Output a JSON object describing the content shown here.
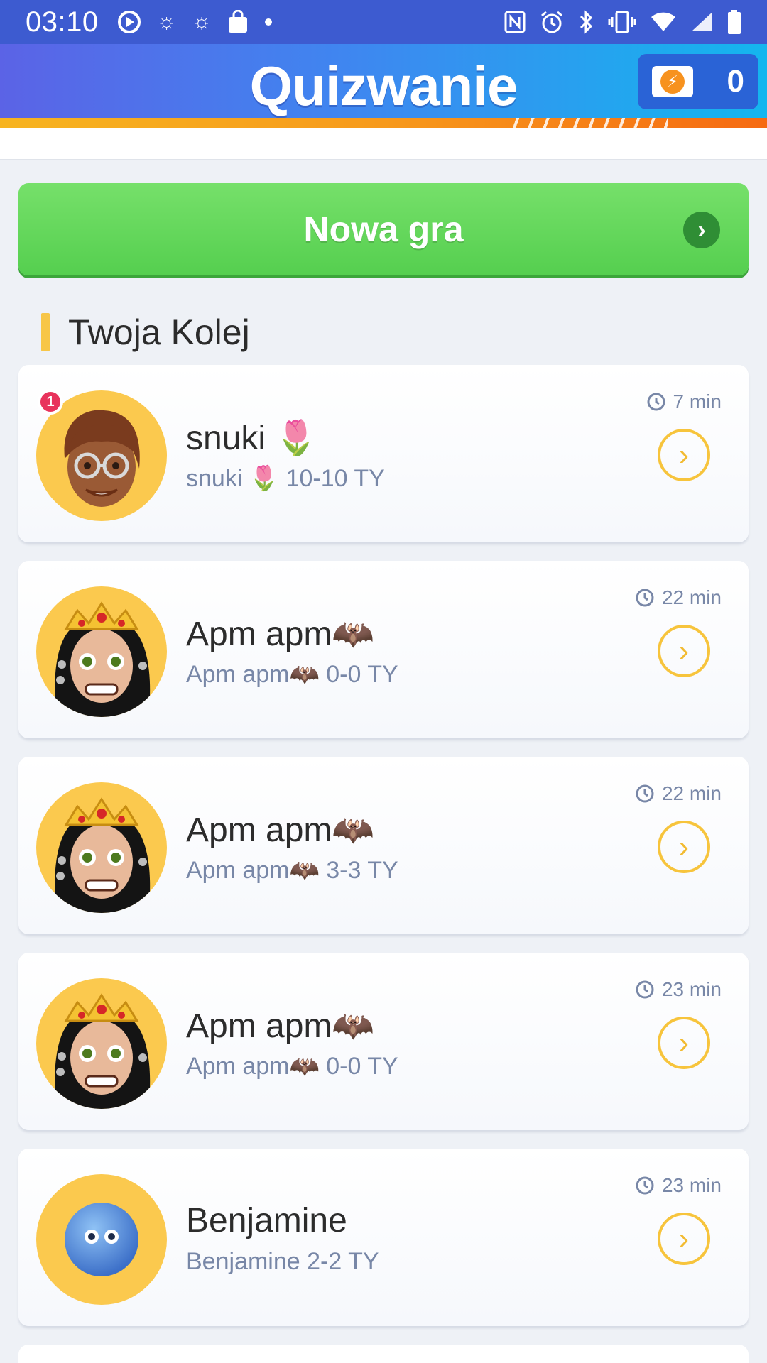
{
  "status_bar": {
    "time": "03:10",
    "left_icons": [
      "play-circle-icon",
      "brightness-icon",
      "brightness-icon",
      "shopping-bag-icon",
      "dot-icon"
    ],
    "right_icons": [
      "nfc-icon",
      "alarm-icon",
      "bluetooth-icon",
      "vibrate-icon",
      "wifi-icon",
      "signal-icon",
      "battery-icon"
    ]
  },
  "header": {
    "title": "Quizwanie",
    "coins": "0"
  },
  "new_game": {
    "label": "Nowa gra"
  },
  "section": {
    "title": "Twoja Kolej"
  },
  "games": [
    {
      "name": "snuki 🌷",
      "detail": "snuki 🌷 10-10 TY",
      "time": "7 min",
      "badge": "1",
      "avatar": "woman-glasses-avatar"
    },
    {
      "name": "Apm apm🦇",
      "detail": "Apm apm🦇 0-0 TY",
      "time": "22 min",
      "avatar": "crowned-face-avatar"
    },
    {
      "name": "Apm apm🦇",
      "detail": "Apm apm🦇 3-3 TY",
      "time": "22 min",
      "avatar": "crowned-face-avatar"
    },
    {
      "name": "Apm apm🦇",
      "detail": "Apm apm🦇 0-0 TY",
      "time": "23 min",
      "avatar": "crowned-face-avatar"
    },
    {
      "name": "Benjamine",
      "detail": "Benjamine 2-2 TY",
      "time": "23 min",
      "avatar": "blue-ball-avatar"
    }
  ],
  "colors": {
    "status_bar": "#3d5bd0",
    "green_button": "#5fd75a",
    "accent_yellow": "#f7c43c",
    "badge_red": "#e8335c"
  }
}
